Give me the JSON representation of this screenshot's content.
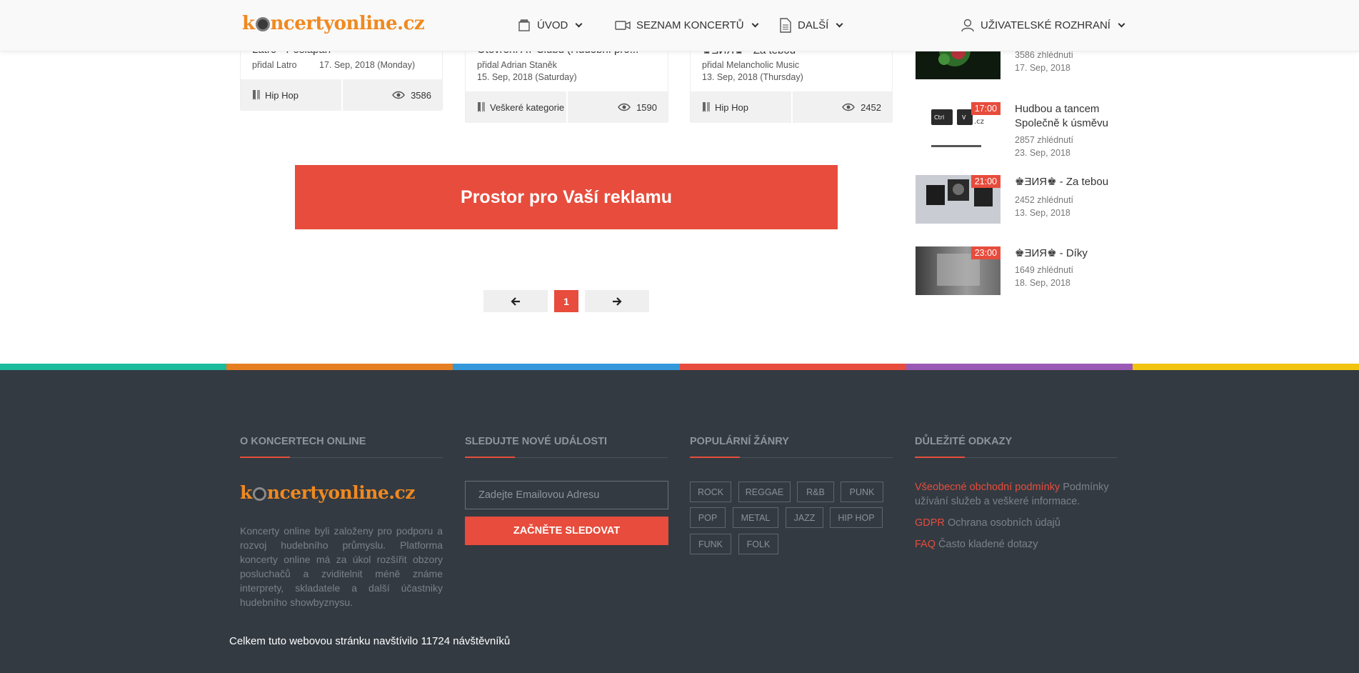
{
  "header": {
    "logo": {
      "pre": "k",
      "post": "ncertyonline.cz"
    },
    "nav": [
      {
        "label": "ÚVOD",
        "icon": "archive-icon"
      },
      {
        "label": "SEZNAM KONCERTŮ",
        "icon": "video-camera-icon"
      },
      {
        "label": "DALŠÍ",
        "icon": "document-icon"
      },
      {
        "label": "UŽIVATELSKÉ ROZHRANÍ",
        "icon": "user-icon"
      }
    ]
  },
  "cards": [
    {
      "title": "Latro - Poslapan",
      "author": "přidal Latro",
      "date": "17. Sep, 2018 (Monday)",
      "category": "Hip Hop",
      "views": "3586"
    },
    {
      "title": "Otevření AT Clubu (Hudební pro...",
      "author": "přidal Adrian Staněk",
      "date": "15. Sep, 2018 (Saturday)",
      "category": "Veškeré kategorie",
      "views": "1590"
    },
    {
      "title": "♚ƎИЯ♚ - Za tebou",
      "author": "přidal Melancholic Music",
      "date": "13. Sep, 2018 (Thursday)",
      "category": "Hip Hop",
      "views": "2452"
    }
  ],
  "ad": {
    "text": "Prostor pro Vaší reklamu"
  },
  "pagination": {
    "current": "1"
  },
  "sidebar": [
    {
      "time": "",
      "title": "",
      "views": "3586 zhlédnutí",
      "date": "17. Sep, 2018"
    },
    {
      "time": "17:00",
      "title": "Hudbou a tancem Společně k úsměvu",
      "views": "2857 zhlédnutí",
      "date": "23. Sep, 2018"
    },
    {
      "time": "21:00",
      "title": "♚ƎИЯ♚ - Za tebou",
      "views": "2452 zhlédnutí",
      "date": "13. Sep, 2018"
    },
    {
      "time": "23:00",
      "title": "♚ƎИЯ♚ - Díky",
      "views": "1649 zhlédnutí",
      "date": "18. Sep, 2018"
    }
  ],
  "stripe_colors": [
    "#1abc9c",
    "#e67e22",
    "#3498db",
    "#e74c3c",
    "#9b59b6",
    "#f1c40f"
  ],
  "footer": {
    "about": {
      "heading": "O KONCERTECH ONLINE",
      "logo": {
        "pre": "k",
        "post": "ncertyonline.cz"
      },
      "text": "Koncerty online byli založeny pro podporu a rozvoj hudebního průmyslu. Platforma koncerty online má za úkol rozšířit obzory posluchačů a zviditelnit méně známe interprety, skladatele a další účastniky hudebního showbyznysu."
    },
    "subscribe": {
      "heading": "SLEDUJTE NOVÉ UDÁLOSTI",
      "placeholder": "Zadejte Emailovou Adresu",
      "button": "ZAČNĚTE SLEDOVAT"
    },
    "genres": {
      "heading": "POPULÁRNÍ ŽÁNRY",
      "tags": [
        "ROCK",
        "REGGAE",
        "R&B",
        "PUNK",
        "POP",
        "METAL",
        "JAZZ",
        "HIP HOP",
        "FUNK",
        "FOLK"
      ]
    },
    "links": {
      "heading": "DŮLEŽITÉ ODKAZY",
      "items": [
        {
          "link": "Všeobecné obchodní podmínky",
          "desc": "Podmínky užívání služeb a veškeré informace."
        },
        {
          "link": "GDPR",
          "desc": "Ochrana osobních údajů"
        },
        {
          "link": "FAQ",
          "desc": "Často kladené dotazy"
        }
      ]
    },
    "visits": "Celkem tuto webovou stránku navštívilo 11724 návštěvníků"
  }
}
